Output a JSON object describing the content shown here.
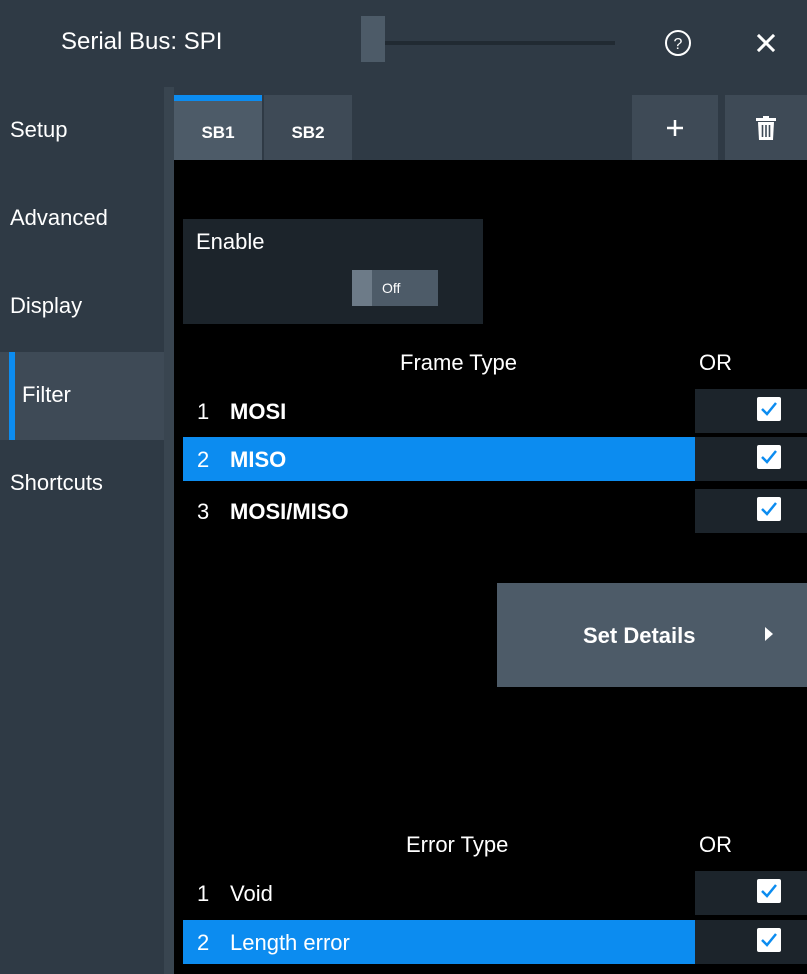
{
  "window": {
    "title": "Serial Bus: SPI"
  },
  "icons": {
    "help": "help-circle-icon",
    "close": "close-icon",
    "add": "plus-icon",
    "delete": "trash-icon",
    "check": "checkmark-icon",
    "arrow": "chevron-right-icon"
  },
  "colors": {
    "accent": "#0c8cf0",
    "panel": "#2f3a45",
    "background": "#000000",
    "button": "#4d5b68"
  },
  "sidebar": {
    "items": [
      {
        "label": "Setup"
      },
      {
        "label": "Advanced"
      },
      {
        "label": "Display"
      },
      {
        "label": "Filter",
        "active": true
      },
      {
        "label": "Shortcuts"
      }
    ]
  },
  "tabs": [
    {
      "label": "SB1",
      "active": true
    },
    {
      "label": "SB2"
    }
  ],
  "enable": {
    "label": "Enable",
    "state": "Off"
  },
  "frame_type": {
    "header": "Frame Type",
    "or_header": "OR",
    "rows": [
      {
        "num": "1",
        "label": "MOSI",
        "checked": true
      },
      {
        "num": "2",
        "label": "MISO",
        "checked": true,
        "selected": true
      },
      {
        "num": "3",
        "label": "MOSI/MISO",
        "checked": true
      }
    ]
  },
  "set_details": {
    "label": "Set Details"
  },
  "error_type": {
    "header": "Error Type",
    "or_header": "OR",
    "rows": [
      {
        "num": "1",
        "label": "Void",
        "checked": true
      },
      {
        "num": "2",
        "label": "Length error",
        "checked": true,
        "selected": true
      }
    ]
  }
}
